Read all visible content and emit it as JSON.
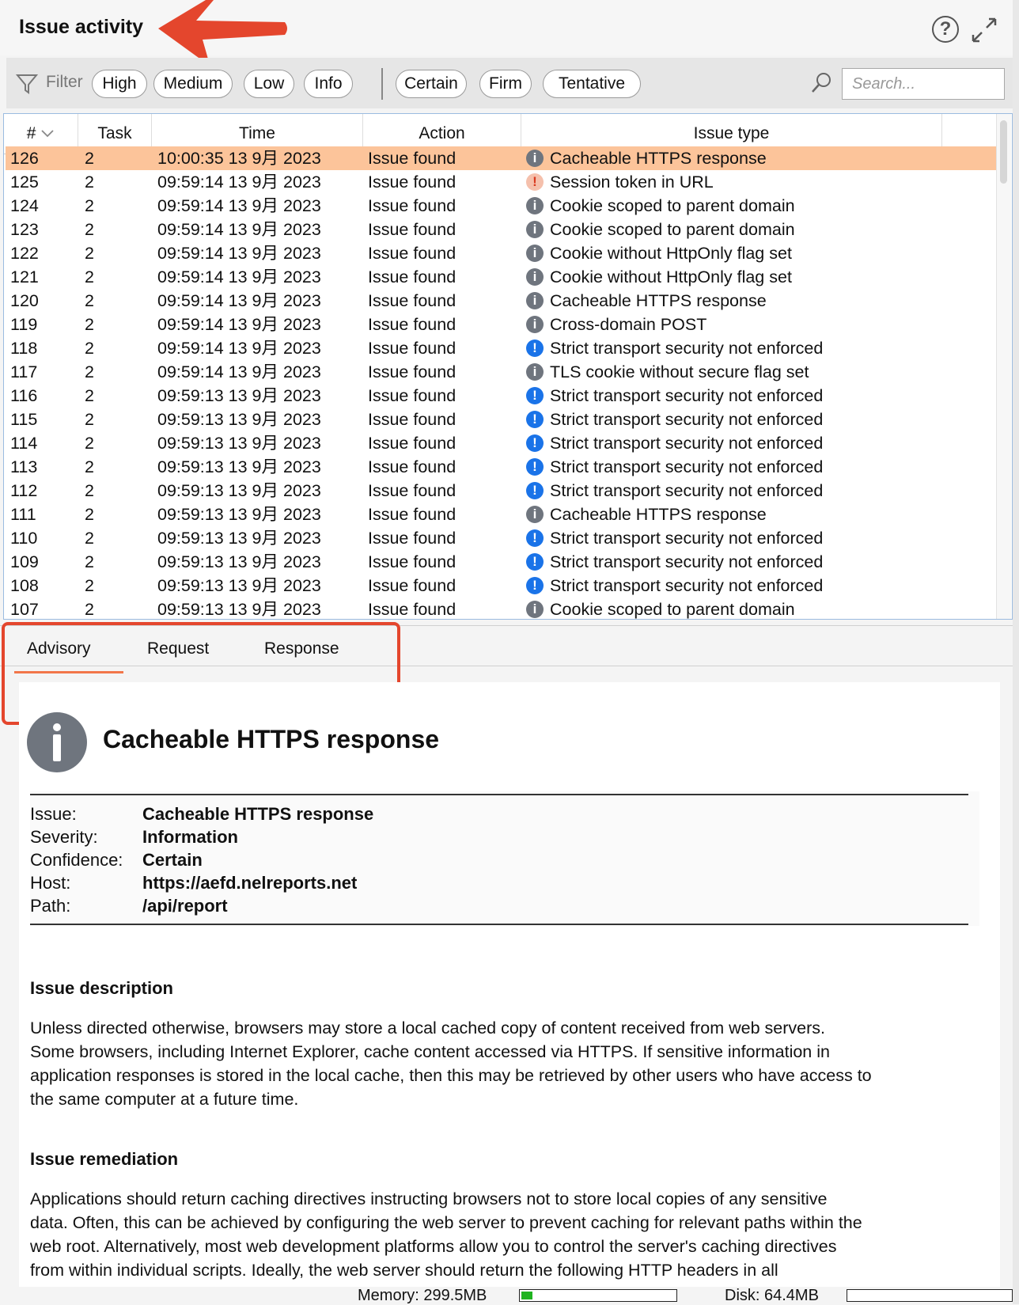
{
  "header": {
    "title": "Issue activity"
  },
  "filter": {
    "label": "Filter",
    "severity_chips": [
      "High",
      "Medium",
      "Low",
      "Info"
    ],
    "confidence_chips": [
      "Certain",
      "Firm",
      "Tentative"
    ],
    "search_placeholder": "Search..."
  },
  "table": {
    "columns": [
      "#",
      "Task",
      "Time",
      "Action",
      "Issue type"
    ],
    "rows": [
      {
        "num": "126",
        "task": "2",
        "time": "10:00:35 13 9月 2023",
        "action": "Issue found",
        "sev": "info",
        "type": "Cacheable HTTPS response",
        "selected": true
      },
      {
        "num": "125",
        "task": "2",
        "time": "09:59:14 13 9月 2023",
        "action": "Issue found",
        "sev": "high",
        "type": "Session token in URL"
      },
      {
        "num": "124",
        "task": "2",
        "time": "09:59:14 13 9月 2023",
        "action": "Issue found",
        "sev": "info",
        "type": "Cookie scoped to parent domain"
      },
      {
        "num": "123",
        "task": "2",
        "time": "09:59:14 13 9月 2023",
        "action": "Issue found",
        "sev": "info",
        "type": "Cookie scoped to parent domain"
      },
      {
        "num": "122",
        "task": "2",
        "time": "09:59:14 13 9月 2023",
        "action": "Issue found",
        "sev": "info",
        "type": "Cookie without HttpOnly flag set"
      },
      {
        "num": "121",
        "task": "2",
        "time": "09:59:14 13 9月 2023",
        "action": "Issue found",
        "sev": "info",
        "type": "Cookie without HttpOnly flag set"
      },
      {
        "num": "120",
        "task": "2",
        "time": "09:59:14 13 9月 2023",
        "action": "Issue found",
        "sev": "info",
        "type": "Cacheable HTTPS response"
      },
      {
        "num": "119",
        "task": "2",
        "time": "09:59:14 13 9月 2023",
        "action": "Issue found",
        "sev": "info",
        "type": "Cross-domain POST"
      },
      {
        "num": "118",
        "task": "2",
        "time": "09:59:14 13 9月 2023",
        "action": "Issue found",
        "sev": "low",
        "type": "Strict transport security not enforced"
      },
      {
        "num": "117",
        "task": "2",
        "time": "09:59:14 13 9月 2023",
        "action": "Issue found",
        "sev": "info",
        "type": "TLS cookie without secure flag set"
      },
      {
        "num": "116",
        "task": "2",
        "time": "09:59:13 13 9月 2023",
        "action": "Issue found",
        "sev": "low",
        "type": "Strict transport security not enforced"
      },
      {
        "num": "115",
        "task": "2",
        "time": "09:59:13 13 9月 2023",
        "action": "Issue found",
        "sev": "low",
        "type": "Strict transport security not enforced"
      },
      {
        "num": "114",
        "task": "2",
        "time": "09:59:13 13 9月 2023",
        "action": "Issue found",
        "sev": "low",
        "type": "Strict transport security not enforced"
      },
      {
        "num": "113",
        "task": "2",
        "time": "09:59:13 13 9月 2023",
        "action": "Issue found",
        "sev": "low",
        "type": "Strict transport security not enforced"
      },
      {
        "num": "112",
        "task": "2",
        "time": "09:59:13 13 9月 2023",
        "action": "Issue found",
        "sev": "low",
        "type": "Strict transport security not enforced"
      },
      {
        "num": "111",
        "task": "2",
        "time": "09:59:13 13 9月 2023",
        "action": "Issue found",
        "sev": "info",
        "type": "Cacheable HTTPS response"
      },
      {
        "num": "110",
        "task": "2",
        "time": "09:59:13 13 9月 2023",
        "action": "Issue found",
        "sev": "low",
        "type": "Strict transport security not enforced"
      },
      {
        "num": "109",
        "task": "2",
        "time": "09:59:13 13 9月 2023",
        "action": "Issue found",
        "sev": "low",
        "type": "Strict transport security not enforced"
      },
      {
        "num": "108",
        "task": "2",
        "time": "09:59:13 13 9月 2023",
        "action": "Issue found",
        "sev": "low",
        "type": "Strict transport security not enforced"
      },
      {
        "num": "107",
        "task": "2",
        "time": "09:59:13 13 9月 2023",
        "action": "Issue found",
        "sev": "info",
        "type": "Cookie scoped to parent domain"
      }
    ]
  },
  "tabs": [
    "Advisory",
    "Request",
    "Response"
  ],
  "advisory": {
    "title": "Cacheable HTTPS response",
    "fields": [
      {
        "label": "Issue:",
        "value": "Cacheable HTTPS response"
      },
      {
        "label": "Severity:",
        "value": "Information"
      },
      {
        "label": "Confidence:",
        "value": "Certain"
      },
      {
        "label": "Host:",
        "value": "https://aefd.nelreports.net"
      },
      {
        "label": "Path:",
        "value": "/api/report"
      }
    ],
    "description_heading": "Issue description",
    "description_lines": [
      "Unless directed otherwise, browsers may store a local cached copy of content received from web servers.",
      "Some browsers, including Internet Explorer, cache content accessed via HTTPS. If sensitive information in",
      "application responses is stored in the local cache, then this may be retrieved by other users who have access to",
      "the same computer at a future time."
    ],
    "remediation_heading": "Issue remediation",
    "remediation_lines": [
      "Applications should return caching directives instructing browsers not to store local copies of any sensitive",
      "data. Often, this can be achieved by configuring the web server to prevent caching for relevant paths within the",
      "web root. Alternatively, most web development platforms allow you to control the server's caching directives",
      "from within individual scripts. Ideally, the web server should return the following HTTP headers in all"
    ]
  },
  "status": {
    "memory_label": "Memory: 299.5MB",
    "memory_fill": 0.07,
    "disk_label": "Disk: 64.4MB",
    "disk_fill": 0.0
  },
  "colors": {
    "selected_row": "#fcc49a",
    "info_icon": "#6f757e",
    "high_icon": "#f5c0ac",
    "low_icon": "#1a73e8",
    "accent": "#f2764a",
    "annotation": "#e4462d"
  },
  "icons": [
    "filter-icon",
    "search-icon",
    "help-icon",
    "expand-icon",
    "sort-chevron-icon",
    "info-icon",
    "high-severity-icon",
    "low-severity-icon"
  ]
}
